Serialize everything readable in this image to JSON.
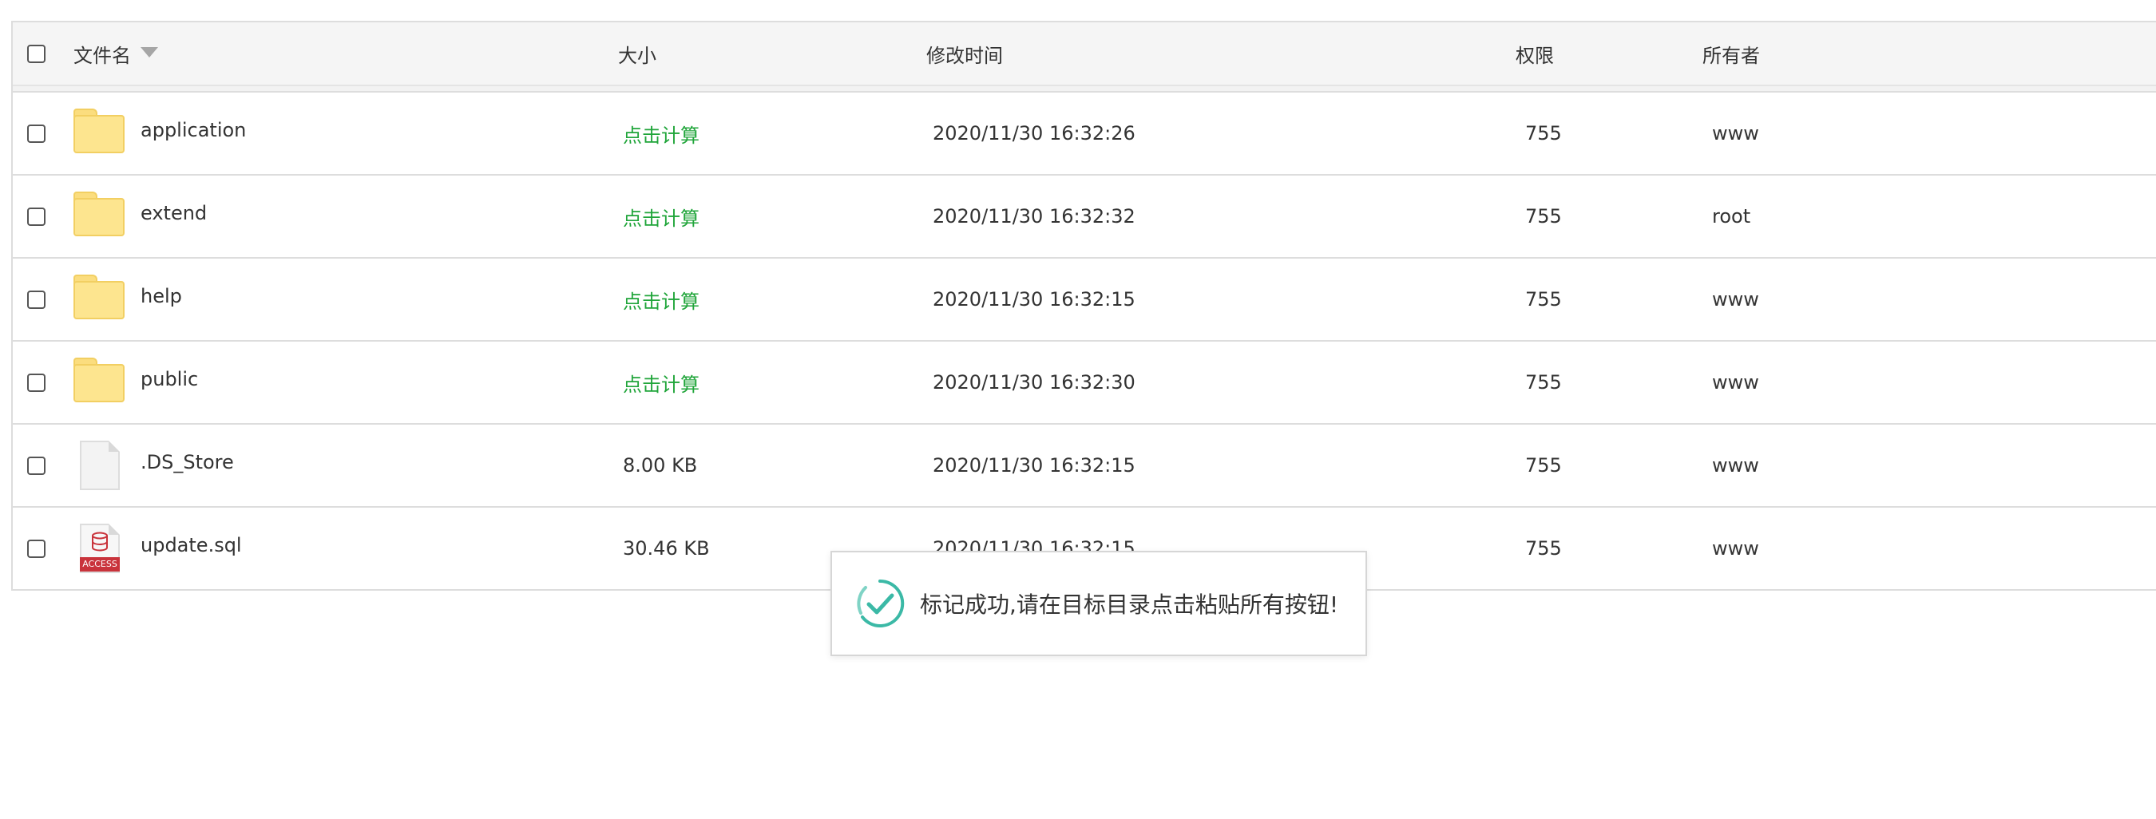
{
  "header": {
    "filename_label": "文件名",
    "size_label": "大小",
    "mtime_label": "修改时间",
    "perm_label": "权限",
    "owner_label": "所有者"
  },
  "rows": [
    {
      "name": "application",
      "type": "folder",
      "size": "点击计算",
      "size_is_link": true,
      "mtime": "2020/11/30 16:32:26",
      "perm": "755",
      "owner": "www"
    },
    {
      "name": "extend",
      "type": "folder",
      "size": "点击计算",
      "size_is_link": true,
      "mtime": "2020/11/30 16:32:32",
      "perm": "755",
      "owner": "root"
    },
    {
      "name": "help",
      "type": "folder",
      "size": "点击计算",
      "size_is_link": true,
      "mtime": "2020/11/30 16:32:15",
      "perm": "755",
      "owner": "www"
    },
    {
      "name": "public",
      "type": "folder",
      "size": "点击计算",
      "size_is_link": true,
      "mtime": "2020/11/30 16:32:30",
      "perm": "755",
      "owner": "www"
    },
    {
      "name": ".DS_Store",
      "type": "file",
      "size": "8.00 KB",
      "size_is_link": false,
      "mtime": "2020/11/30 16:32:15",
      "perm": "755",
      "owner": "www"
    },
    {
      "name": "update.sql",
      "type": "sql",
      "icon_badge": "ACCESS",
      "size": "30.46 KB",
      "size_is_link": false,
      "mtime": "2020/11/30 16:32:15",
      "perm": "755",
      "owner": "www"
    }
  ],
  "toast": {
    "message": "标记成功,请在目标目录点击粘贴所有按钮!",
    "icon": "check-circle-icon"
  },
  "colors": {
    "link_green": "#20a53a",
    "folder_yellow": "#fde58f",
    "toast_check": "#3bb9a6",
    "sql_red": "#c9333b"
  }
}
